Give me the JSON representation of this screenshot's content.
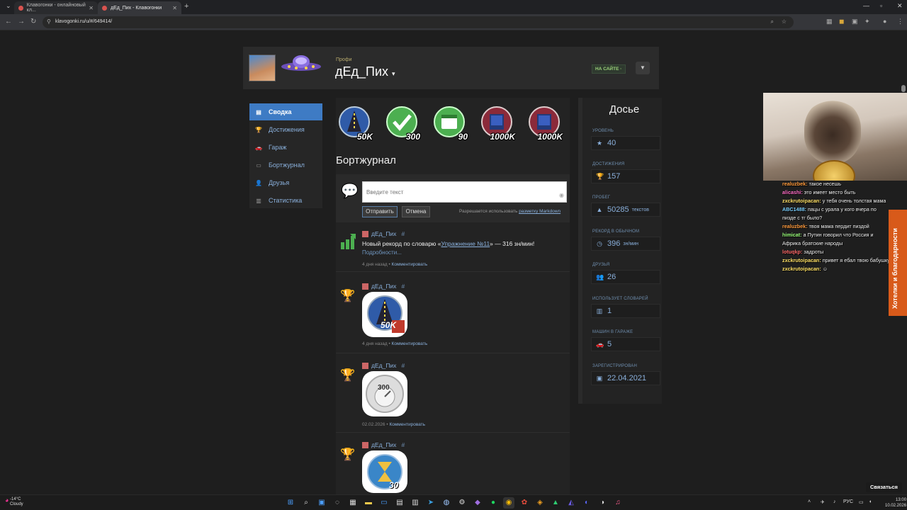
{
  "browser": {
    "tabs": [
      {
        "title": "Клавогонки - онлайновый кл..."
      },
      {
        "title": "дЕд_Пих - Клавогонки"
      }
    ],
    "url": "klavogonki.ru/u/#/649414/"
  },
  "profile": {
    "rank": "Профи",
    "username": "дЕд_Пих",
    "status": "НА САЙТЕ"
  },
  "sidebar": {
    "items": [
      {
        "label": "Сводка",
        "icon": "summary-icon"
      },
      {
        "label": "Достижения",
        "icon": "trophy-icon"
      },
      {
        "label": "Гараж",
        "icon": "car-icon"
      },
      {
        "label": "Бортжурнал",
        "icon": "journal-icon"
      },
      {
        "label": "Друзья",
        "icon": "friends-icon"
      },
      {
        "label": "Статистика",
        "icon": "stats-icon"
      }
    ]
  },
  "badges": [
    {
      "label": "50K",
      "color": "#2f5ba8"
    },
    {
      "label": "300",
      "color": "#4caf50"
    },
    {
      "label": "90",
      "color": "#4caf50"
    },
    {
      "label": "1000K",
      "color": "#8b2a3a"
    },
    {
      "label": "1000K",
      "color": "#8b2a3a"
    }
  ],
  "journal": {
    "title": "Бортжурнал",
    "placeholder": "Введите текст",
    "send": "Отправить",
    "cancel": "Отмена",
    "markdown_prefix": "Разрешается использовать",
    "markdown_link": "разметку Markdown",
    "entries": [
      {
        "user": "дЕд_Пих",
        "hash": "#",
        "text_before": "Новый рекорд по словарю «",
        "dict_link": "Упражнение №11",
        "text_after": "» — 316 зн/мин!",
        "more": "Подробности...",
        "time": "4 дня назад",
        "comment": "Комментировать"
      },
      {
        "user": "дЕд_Пих",
        "hash": "#",
        "badge_label": "50K",
        "time": "4 дня назад",
        "comment": "Комментировать"
      },
      {
        "user": "дЕд_Пих",
        "hash": "#",
        "badge_label": "300",
        "time": "02.02.2026",
        "comment": "Комментировать"
      },
      {
        "user": "дЕд_Пих",
        "hash": "#",
        "badge_label": "30"
      }
    ]
  },
  "dossier": {
    "title": "Досье",
    "stats": [
      {
        "label": "УРОВЕНЬ",
        "value": "40",
        "unit": "",
        "icon": "star-icon"
      },
      {
        "label": "ДОСТИЖЕНИЯ",
        "value": "157",
        "unit": "",
        "icon": "trophy-icon"
      },
      {
        "label": "ПРОБЕГ",
        "value": "50285",
        "unit": "текстов",
        "icon": "road-icon"
      },
      {
        "label": "РЕКОРД В ОБЫЧНОМ",
        "value": "396",
        "unit": "зн/мин",
        "icon": "speed-icon"
      },
      {
        "label": "ДРУЗЬЯ",
        "value": "26",
        "unit": "",
        "icon": "friends-icon"
      },
      {
        "label": "ИСПОЛЬЗУЕТ СЛОВАРЕЙ",
        "value": "1",
        "unit": "",
        "icon": "book-icon"
      },
      {
        "label": "МАШИН В ГАРАЖЕ",
        "value": "5",
        "unit": "",
        "icon": "car-icon"
      },
      {
        "label": "ЗАРЕГИСТРИРОВАН",
        "value": "22.04.2021",
        "unit": "",
        "icon": "calendar-icon"
      }
    ]
  },
  "stream": {
    "chat": [
      {
        "user": "realuzbek:",
        "color": "#ff9a3c",
        "msg": "такое несешь"
      },
      {
        "user": "alicashi:",
        "color": "#ff6ec7",
        "msg": "это имеет место быть"
      },
      {
        "user": "zxckrutoipacan:",
        "color": "#ffe066",
        "msg": "у тебя очень толстая мама"
      },
      {
        "user": "ABC1488:",
        "color": "#7ad0ff",
        "msg": "пацы с урала у кого вчера по"
      },
      {
        "user": "",
        "color": "#eeeeee",
        "msg": "пизде с тг было?"
      },
      {
        "user": "realuzbek:",
        "color": "#ff9a3c",
        "msg": "твоя мама пердит пиздой"
      },
      {
        "user": "himicat:",
        "color": "#9bff7a",
        "msg": "а Путин говорил что Россия и"
      },
      {
        "user": "",
        "color": "#eeeeee",
        "msg": "Африка братские народы"
      },
      {
        "user": "lotuqkp:",
        "color": "#ff6b6b",
        "msg": "задроты"
      },
      {
        "user": "zxckrutoipacan:",
        "color": "#ffe066",
        "msg": "привет я ебал твою бабушку"
      },
      {
        "user": "zxckrutoipacan:",
        "color": "#ffe066",
        "msg": "☺"
      }
    ],
    "banner": "Хотелки и благодарности",
    "connect": "Связаться"
  },
  "taskbar": {
    "temp": "-14°C",
    "weather": "Cloudy",
    "lang": "РУС",
    "time": "13:00",
    "date": "10.02.2026"
  }
}
